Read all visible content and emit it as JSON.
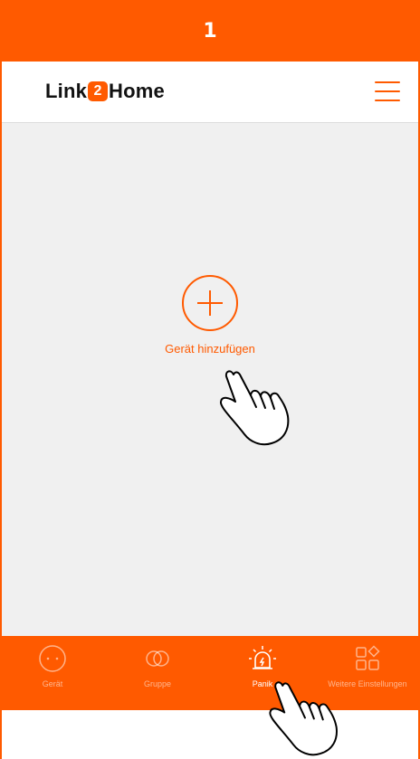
{
  "step": {
    "number": "1"
  },
  "header": {
    "brand_pre": "Link",
    "brand_badge": "2",
    "brand_post": "Home",
    "menu_icon": "hamburger-menu-icon"
  },
  "main": {
    "add_device_label": "Gerät hinzufügen",
    "add_icon": "plus-circle-icon"
  },
  "tabs": [
    {
      "label": "Gerät",
      "icon": "socket-icon",
      "active": false
    },
    {
      "label": "Gruppe",
      "icon": "link-rings-icon",
      "active": false
    },
    {
      "label": "Panik",
      "icon": "alarm-siren-icon",
      "active": true
    },
    {
      "label": "Weitere Einstellungen",
      "icon": "apps-grid-icon",
      "active": false
    }
  ],
  "colors": {
    "accent": "#ff5a00",
    "background": "#f0f0f0"
  }
}
